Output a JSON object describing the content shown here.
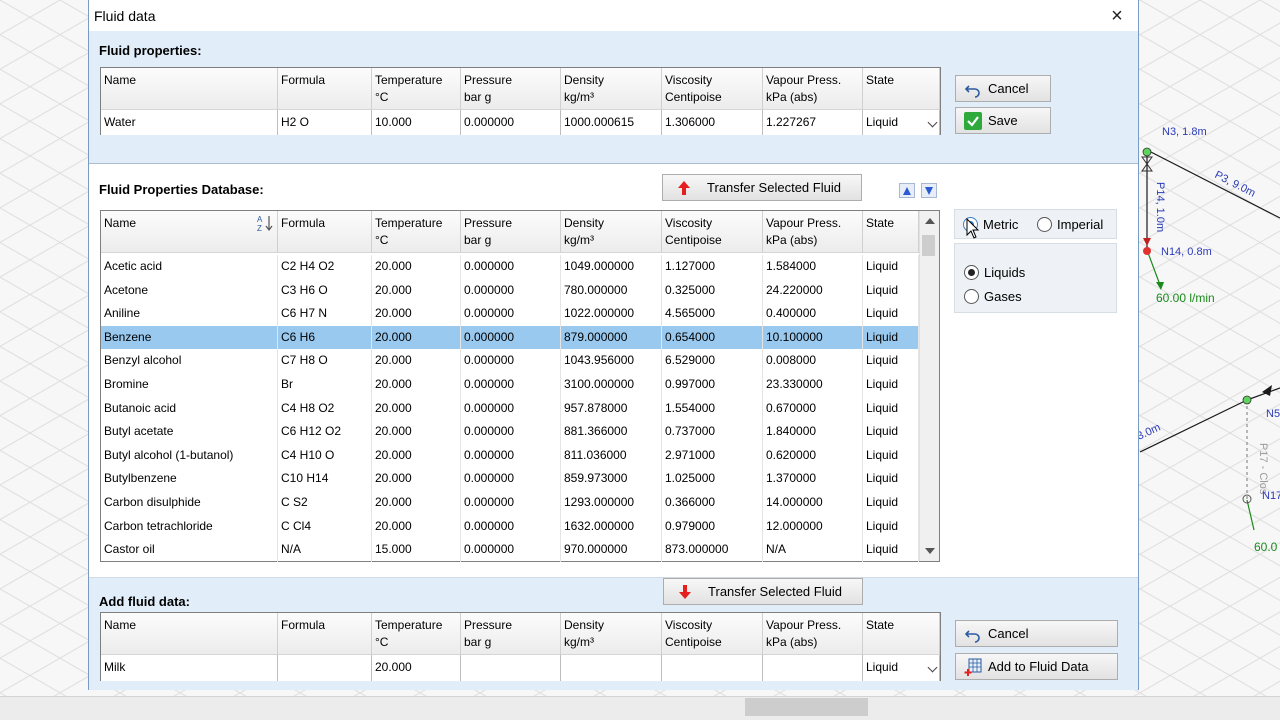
{
  "window": {
    "title": "Fluid data",
    "close_label": "×"
  },
  "columns": [
    {
      "line1": "Name",
      "line2": ""
    },
    {
      "line1": "Formula",
      "line2": ""
    },
    {
      "line1": "Temperature",
      "line2": "°C"
    },
    {
      "line1": "Pressure",
      "line2": "bar g"
    },
    {
      "line1": "Density",
      "line2": "kg/m³"
    },
    {
      "line1": "Viscosity",
      "line2": "Centipoise"
    },
    {
      "line1": "Vapour Press.",
      "line2": "kPa (abs)"
    },
    {
      "line1": "State",
      "line2": ""
    }
  ],
  "fluid_properties": {
    "label": "Fluid properties:",
    "row": [
      "Water",
      "H2 O",
      "10.000",
      "0.000000",
      "1000.000615",
      "1.306000",
      "1.227267",
      "Liquid"
    ],
    "cancel_label": "Cancel",
    "save_label": "Save"
  },
  "database": {
    "label": "Fluid Properties Database:",
    "transfer_label": "Transfer Selected Fluid",
    "selected_index": 3,
    "rows": [
      [
        "Acetic acid",
        "C2 H4 O2",
        "20.000",
        "0.000000",
        "1049.000000",
        "1.127000",
        "1.584000",
        "Liquid"
      ],
      [
        "Acetone",
        "C3 H6 O",
        "20.000",
        "0.000000",
        "780.000000",
        "0.325000",
        "24.220000",
        "Liquid"
      ],
      [
        "Aniline",
        "C6 H7 N",
        "20.000",
        "0.000000",
        "1022.000000",
        "4.565000",
        "0.400000",
        "Liquid"
      ],
      [
        "Benzene",
        "C6 H6",
        "20.000",
        "0.000000",
        "879.000000",
        "0.654000",
        "10.100000",
        "Liquid"
      ],
      [
        "Benzyl alcohol",
        "C7 H8 O",
        "20.000",
        "0.000000",
        "1043.956000",
        "6.529000",
        "0.008000",
        "Liquid"
      ],
      [
        "Bromine",
        "Br",
        "20.000",
        "0.000000",
        "3100.000000",
        "0.997000",
        "23.330000",
        "Liquid"
      ],
      [
        "Butanoic acid",
        "C4 H8 O2",
        "20.000",
        "0.000000",
        "957.878000",
        "1.554000",
        "0.670000",
        "Liquid"
      ],
      [
        "Butyl acetate",
        "C6 H12 O2",
        "20.000",
        "0.000000",
        "881.366000",
        "0.737000",
        "1.840000",
        "Liquid"
      ],
      [
        "Butyl alcohol (1-butanol)",
        "C4 H10 O",
        "20.000",
        "0.000000",
        "811.036000",
        "2.971000",
        "0.620000",
        "Liquid"
      ],
      [
        "Butylbenzene",
        "C10 H14",
        "20.000",
        "0.000000",
        "859.973000",
        "1.025000",
        "1.370000",
        "Liquid"
      ],
      [
        "Carbon disulphide",
        "C S2",
        "20.000",
        "0.000000",
        "1293.000000",
        "0.366000",
        "14.000000",
        "Liquid"
      ],
      [
        "Carbon tetrachloride",
        "C Cl4",
        "20.000",
        "0.000000",
        "1632.000000",
        "0.979000",
        "12.000000",
        "Liquid"
      ],
      [
        "Castor oil",
        "N/A",
        "15.000",
        "0.000000",
        "970.000000",
        "873.000000",
        "N/A",
        "Liquid"
      ]
    ]
  },
  "units": {
    "metric": "Metric",
    "imperial": "Imperial",
    "selected": "metric"
  },
  "fluid_type": {
    "liquids": "Liquids",
    "gases": "Gases",
    "selected": "liquids"
  },
  "add_fluid": {
    "label": "Add fluid data:",
    "transfer_label": "Transfer Selected Fluid",
    "row": [
      "Milk",
      "",
      "20.000",
      "",
      "",
      "",
      "",
      "Liquid"
    ],
    "cancel_label": "Cancel",
    "add_label": "Add to Fluid Data"
  },
  "canvas": {
    "labels": [
      "N3, 1.8m",
      "P3, 9.0m",
      "P14, 1.0m",
      "N14, 0.8m",
      "60.00 l/min",
      "N5",
      "3.0m",
      "P17 - Clos",
      "N17",
      "60.0"
    ]
  }
}
